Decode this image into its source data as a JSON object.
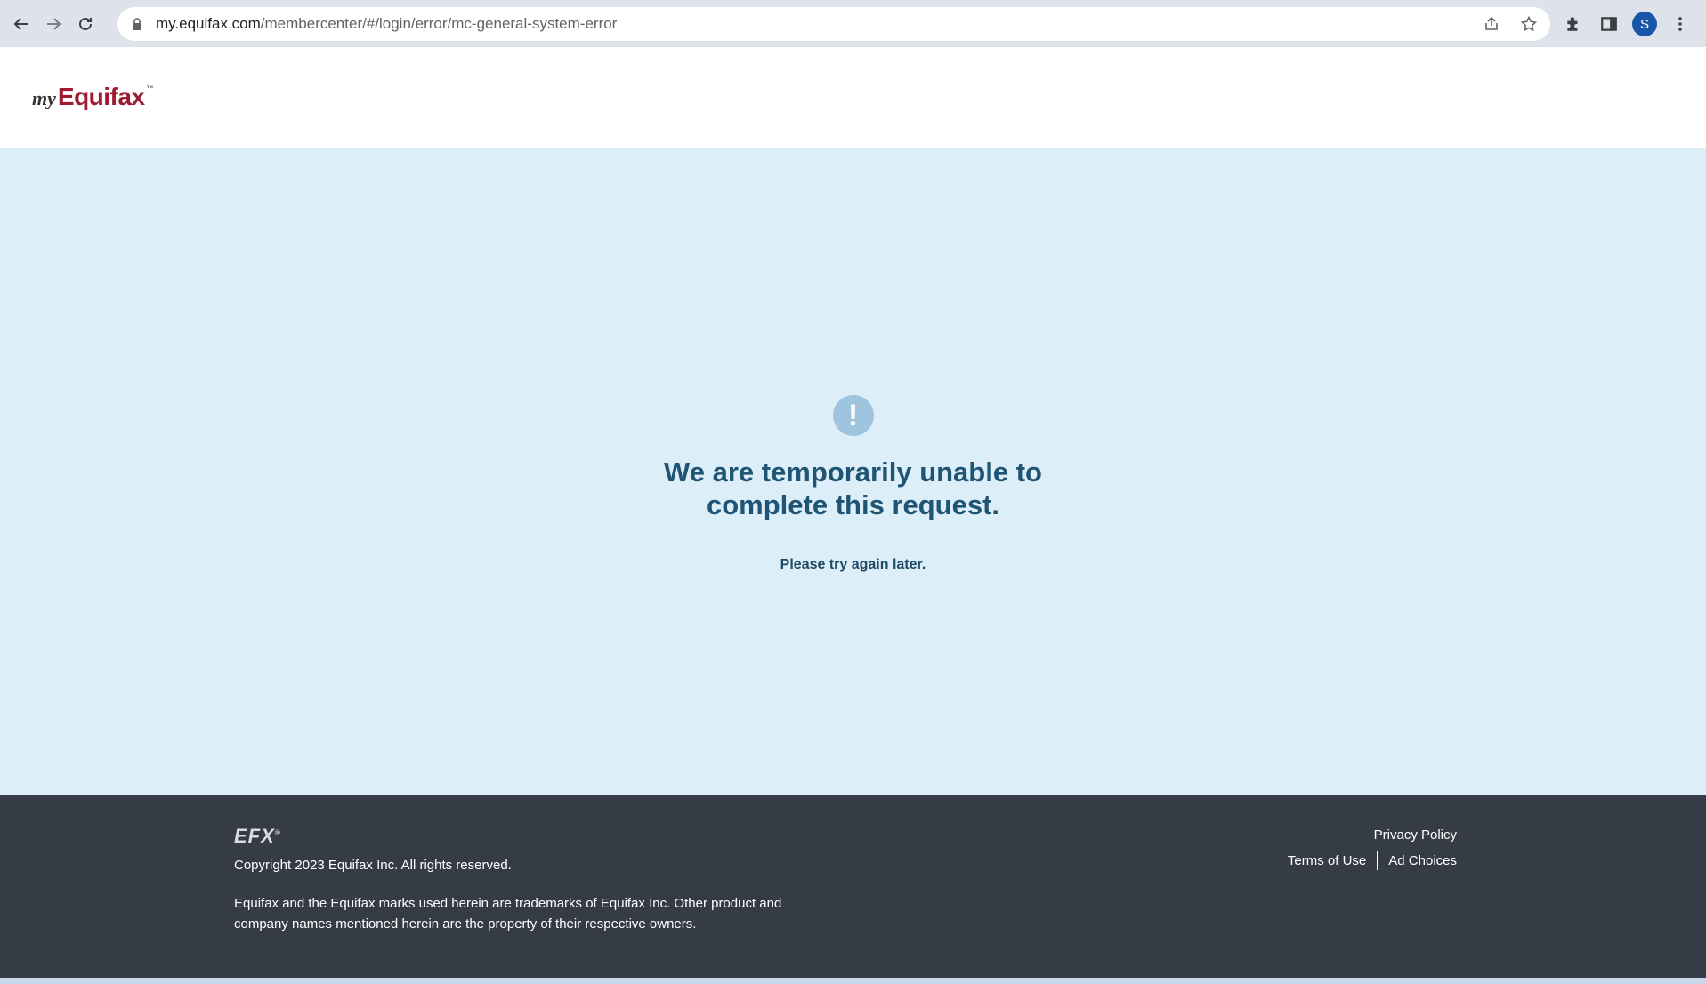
{
  "browser": {
    "url_host": "my.equifax.com",
    "url_path": "/membercenter/#/login/error/mc-general-system-error",
    "profile_initial": "S"
  },
  "header": {
    "logo_prefix": "my",
    "logo_name": "Equifax",
    "logo_tm": "™"
  },
  "error": {
    "icon_glyph": "!",
    "title": "We are temporarily unable to complete this request.",
    "subtitle": "Please try again later."
  },
  "footer": {
    "efx_logo": "EFX",
    "efx_mark": "®",
    "copyright": "Copyright 2023 Equifax Inc. All rights reserved.",
    "trademark": "Equifax and the Equifax marks used herein are trademarks of Equifax Inc. Other product and company names mentioned herein are the property of their respective owners.",
    "links": {
      "privacy": "Privacy Policy",
      "terms": "Terms of Use",
      "ad_choices": "Ad Choices"
    }
  },
  "colors": {
    "brand_red": "#9e1b32",
    "error_title": "#1f5474",
    "main_bg": "#dceef8",
    "footer_bg": "#353c46"
  }
}
